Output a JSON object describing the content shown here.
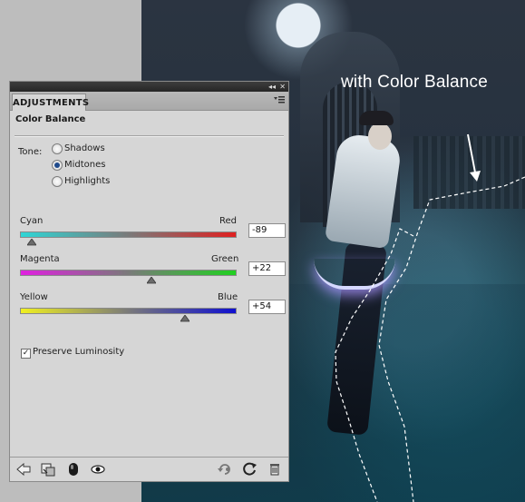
{
  "photo": {
    "caption": "with Color Balance"
  },
  "panel": {
    "tab_label": "ADJUSTMENTS",
    "title": "Color Balance",
    "tone_label": "Tone:",
    "tone_options": [
      {
        "label": "Shadows",
        "selected": false
      },
      {
        "label": "Midtones",
        "selected": true
      },
      {
        "label": "Highlights",
        "selected": false
      }
    ],
    "sliders": [
      {
        "left_label": "Cyan",
        "right_label": "Red",
        "value": "-89",
        "value_num": -89,
        "left_color": "#2fd6d6",
        "right_color": "#e02020"
      },
      {
        "left_label": "Magenta",
        "right_label": "Green",
        "value": "+22",
        "value_num": 22,
        "left_color": "#e020e0",
        "right_color": "#20d020"
      },
      {
        "left_label": "Yellow",
        "right_label": "Blue",
        "value": "+54",
        "value_num": 54,
        "left_color": "#f0f020",
        "right_color": "#1010d0"
      }
    ],
    "preserve_luminosity": {
      "label": "Preserve Luminosity",
      "checked": true
    },
    "footer_icons": [
      "back-arrow-icon",
      "clip-to-layer-icon",
      "layer-mask-icon",
      "visibility-eye-icon",
      "previous-state-icon",
      "reset-icon",
      "trash-icon"
    ]
  }
}
